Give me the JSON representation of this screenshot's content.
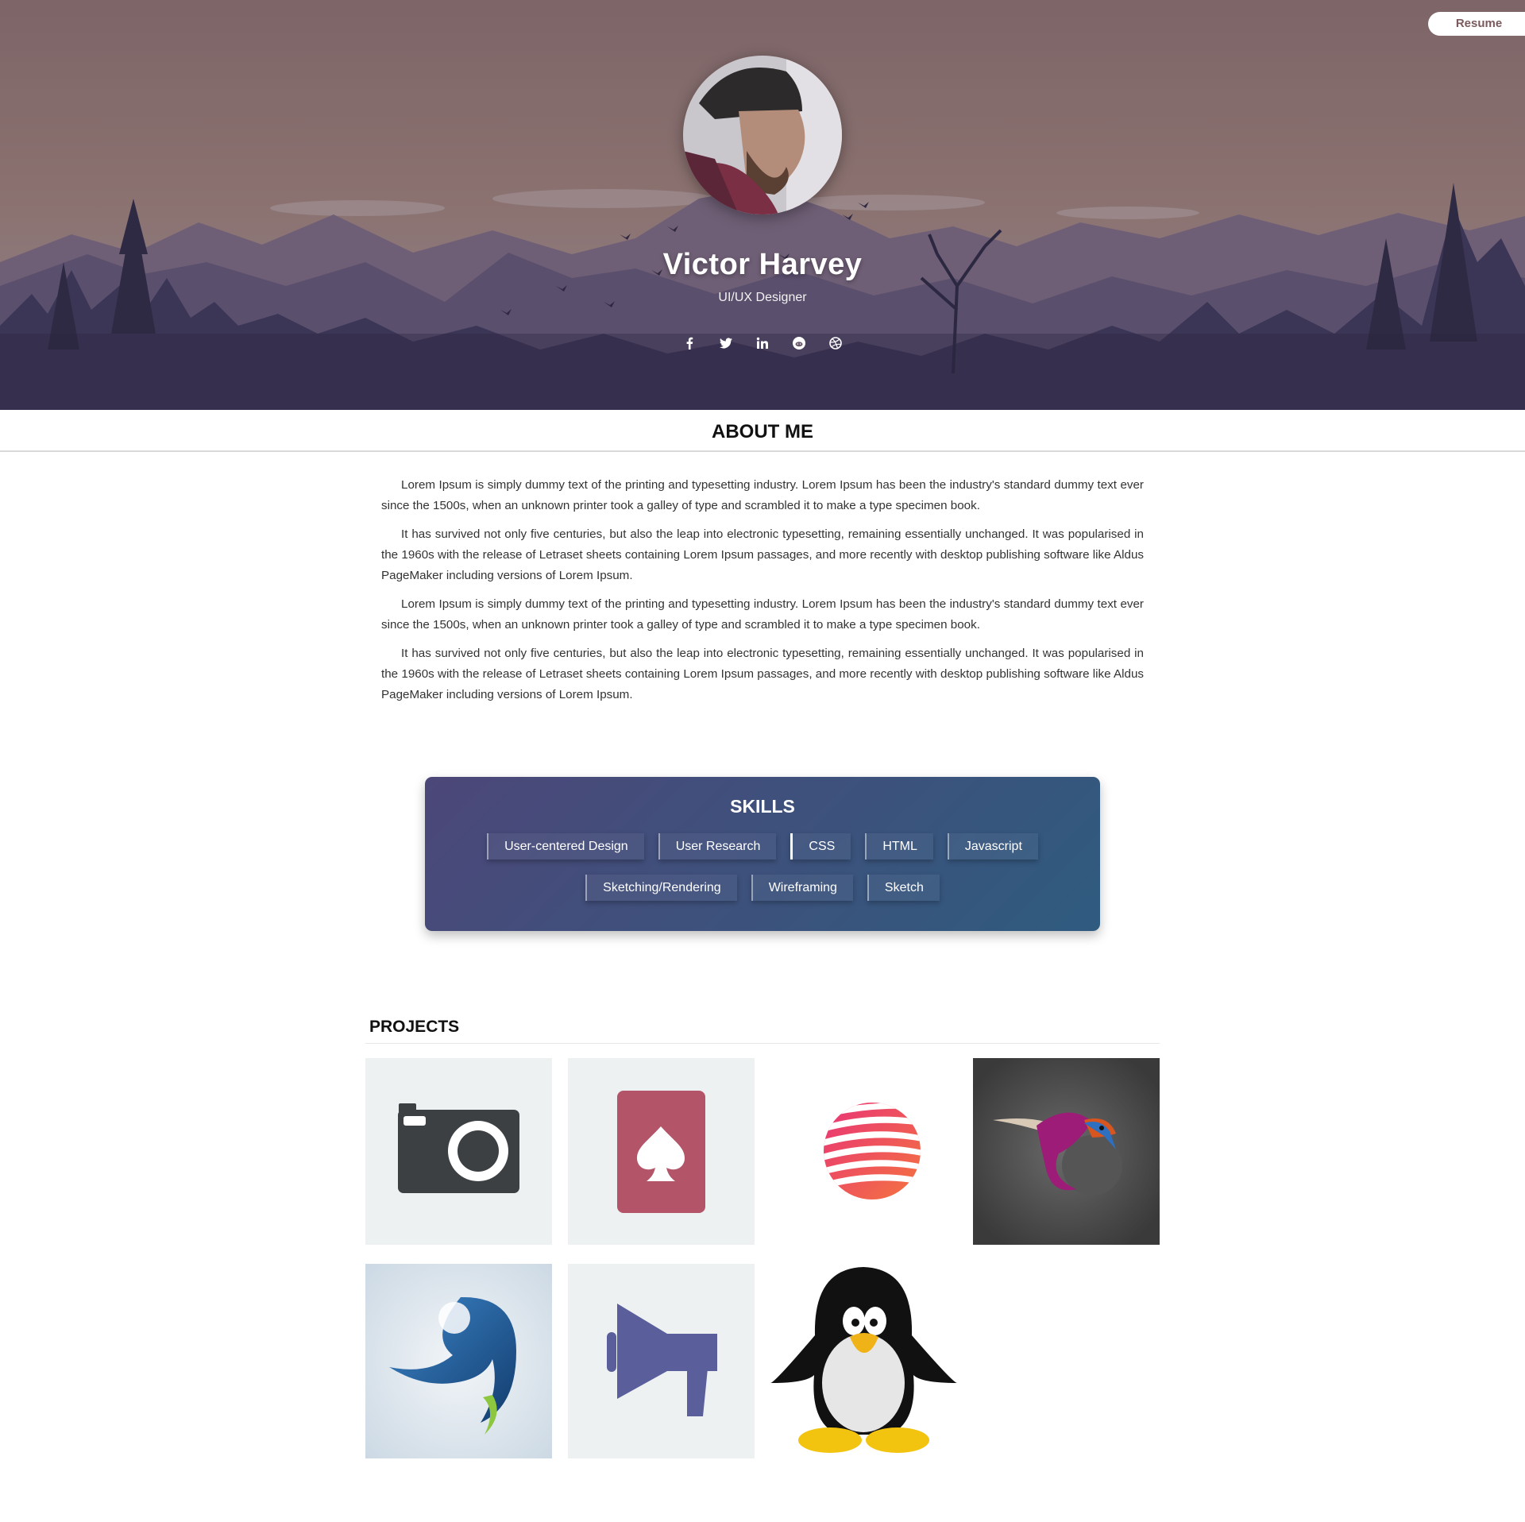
{
  "header": {
    "resume_label": "Resume",
    "name": "Victor Harvey",
    "role": "UI/UX Designer",
    "social_icons": [
      "facebook-icon",
      "twitter-icon",
      "linkedin-icon",
      "reddit-icon",
      "dribbble-icon"
    ]
  },
  "about": {
    "title": "ABOUT ME",
    "paragraphs": [
      "Lorem Ipsum is simply dummy text of the printing and typesetting industry. Lorem Ipsum has been the industry's standard dummy text ever since the 1500s, when an unknown printer took a galley of type and scrambled it to make a type specimen book.",
      "It has survived not only five centuries, but also the leap into electronic typesetting, remaining essentially unchanged. It was popularised in the 1960s with the release of Letraset sheets containing Lorem Ipsum passages, and more recently with desktop publishing software like Aldus PageMaker including versions of Lorem Ipsum.",
      "Lorem Ipsum is simply dummy text of the printing and typesetting industry. Lorem Ipsum has been the industry's standard dummy text ever since the 1500s, when an unknown printer took a galley of type and scrambled it to make a type specimen book.",
      "It has survived not only five centuries, but also the leap into electronic typesetting, remaining essentially unchanged. It was popularised in the 1960s with the release of Letraset sheets containing Lorem Ipsum passages, and more recently with desktop publishing software like Aldus PageMaker including versions of Lorem Ipsum."
    ]
  },
  "skills": {
    "title": "SKILLS",
    "items": [
      "User-centered Design",
      "User Research",
      "CSS",
      "HTML",
      "Javascript",
      "Sketching/Rendering",
      "Wireframing",
      "Sketch"
    ]
  },
  "projects": {
    "title": "PROJECTS",
    "tiles": [
      "camera-icon",
      "spade-card-icon",
      "striped-sphere-logo",
      "hummingbird-logo",
      "blue-bird-logo",
      "megaphone-icon",
      "penguin-logo"
    ]
  },
  "colors": {
    "skills_gradient_start": "#4c4779",
    "skills_gradient_end": "#2f5b7f",
    "resume_text": "#7a5a5d"
  }
}
